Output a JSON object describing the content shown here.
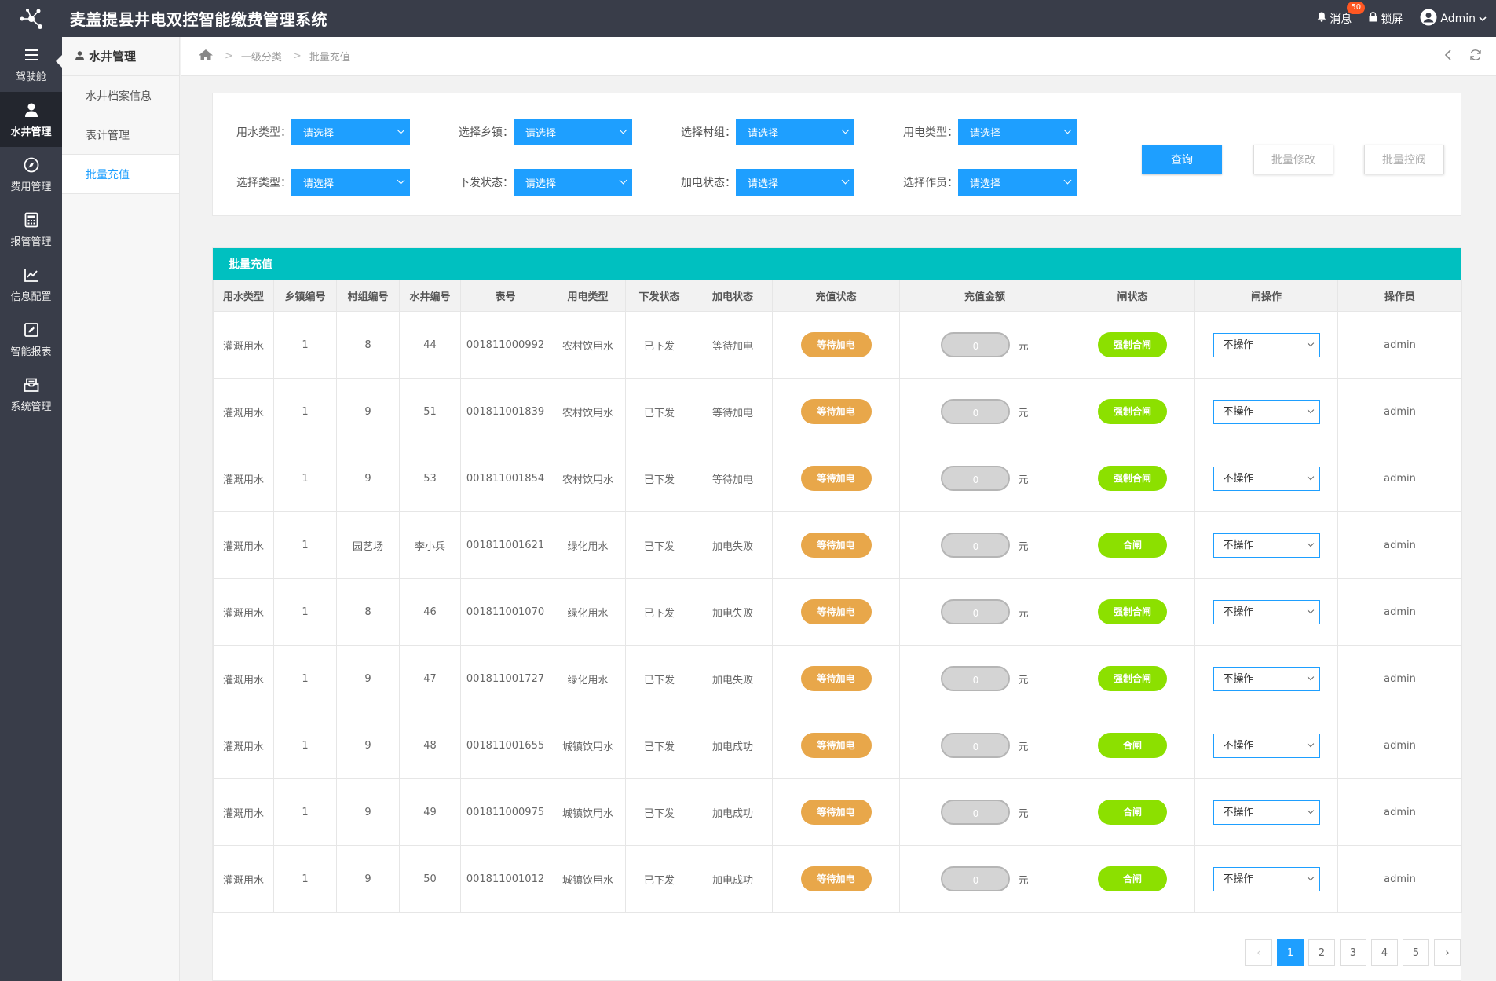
{
  "app": {
    "title": "麦盖提县井电双控智能缴费管理系统"
  },
  "topbar": {
    "messages_label": "消息",
    "messages_count": "50",
    "lock_label": "锁屏",
    "user_label": "Admin"
  },
  "sidebar": {
    "items": [
      {
        "label": "驾驶舱"
      },
      {
        "label": "水井管理"
      },
      {
        "label": "费用管理"
      },
      {
        "label": "报管管理"
      },
      {
        "label": "信息配置"
      },
      {
        "label": "智能报表"
      },
      {
        "label": "系统管理"
      }
    ]
  },
  "submenu": {
    "title": "水井管理",
    "items": [
      {
        "label": "水井档案信息"
      },
      {
        "label": "表计管理"
      },
      {
        "label": "批量充值"
      }
    ]
  },
  "breadcrumb": {
    "level1": "一级分类",
    "level2": "批量充值"
  },
  "filters": {
    "row1": [
      {
        "label": "用水类型：",
        "value": "请选择"
      },
      {
        "label": "选择乡镇：",
        "value": "请选择"
      },
      {
        "label": "选择村组：",
        "value": "请选择"
      },
      {
        "label": "用电类型：",
        "value": "请选择"
      }
    ],
    "row2": [
      {
        "label": "选择类型：",
        "value": "请选择"
      },
      {
        "label": "下发状态：",
        "value": "请选择"
      },
      {
        "label": "加电状态：",
        "value": "请选择"
      },
      {
        "label": "选择作员：",
        "value": "请选择"
      }
    ],
    "query_label": "查询",
    "batch_edit_label": "批量修改",
    "batch_valve_label": "批量控阀"
  },
  "table": {
    "title": "批量充值",
    "headers": [
      "用水类型",
      "乡镇编号",
      "村组编号",
      "水井编号",
      "表号",
      "用电类型",
      "下发状态",
      "加电状态",
      "充值状态",
      "充值金额",
      "闸状态",
      "闸操作",
      "操作员"
    ],
    "unit": "元",
    "rows": [
      {
        "water_type": "灌溉用水",
        "town": "1",
        "village": "8",
        "well": "44",
        "meter": "001811000992",
        "elec_type": "农村饮用水",
        "issue": "已下发",
        "power": "等待加电",
        "recharge": "等待加电",
        "amount": "0",
        "gate": "强制合闸",
        "gate_kind": "green",
        "op": "不操作",
        "operator": "admin"
      },
      {
        "water_type": "灌溉用水",
        "town": "1",
        "village": "9",
        "well": "51",
        "meter": "001811001839",
        "elec_type": "农村饮用水",
        "issue": "已下发",
        "power": "等待加电",
        "recharge": "等待加电",
        "amount": "0",
        "gate": "强制合闸",
        "gate_kind": "green",
        "op": "不操作",
        "operator": "admin"
      },
      {
        "water_type": "灌溉用水",
        "town": "1",
        "village": "9",
        "well": "53",
        "meter": "001811001854",
        "elec_type": "农村饮用水",
        "issue": "已下发",
        "power": "等待加电",
        "recharge": "等待加电",
        "amount": "0",
        "gate": "强制合闸",
        "gate_kind": "green",
        "op": "不操作",
        "operator": "admin"
      },
      {
        "water_type": "灌溉用水",
        "town": "1",
        "village": "园艺场",
        "well": "李小兵",
        "meter": "001811001621",
        "elec_type": "绿化用水",
        "issue": "已下发",
        "power": "加电失败",
        "recharge": "等待加电",
        "amount": "0",
        "gate": "合闸",
        "gate_kind": "green",
        "op": "不操作",
        "operator": "admin"
      },
      {
        "water_type": "灌溉用水",
        "town": "1",
        "village": "8",
        "well": "46",
        "meter": "001811001070",
        "elec_type": "绿化用水",
        "issue": "已下发",
        "power": "加电失败",
        "recharge": "等待加电",
        "amount": "0",
        "gate": "强制合闸",
        "gate_kind": "green",
        "op": "不操作",
        "operator": "admin"
      },
      {
        "water_type": "灌溉用水",
        "town": "1",
        "village": "9",
        "well": "47",
        "meter": "001811001727",
        "elec_type": "绿化用水",
        "issue": "已下发",
        "power": "加电失败",
        "recharge": "等待加电",
        "amount": "0",
        "gate": "强制合闸",
        "gate_kind": "green",
        "op": "不操作",
        "operator": "admin"
      },
      {
        "water_type": "灌溉用水",
        "town": "1",
        "village": "9",
        "well": "48",
        "meter": "001811001655",
        "elec_type": "城镇饮用水",
        "issue": "已下发",
        "power": "加电成功",
        "recharge": "等待加电",
        "amount": "0",
        "gate": "合闸",
        "gate_kind": "green",
        "op": "不操作",
        "operator": "admin"
      },
      {
        "water_type": "灌溉用水",
        "town": "1",
        "village": "9",
        "well": "49",
        "meter": "001811000975",
        "elec_type": "城镇饮用水",
        "issue": "已下发",
        "power": "加电成功",
        "recharge": "等待加电",
        "amount": "0",
        "gate": "合闸",
        "gate_kind": "green",
        "op": "不操作",
        "operator": "admin"
      },
      {
        "water_type": "灌溉用水",
        "town": "1",
        "village": "9",
        "well": "50",
        "meter": "001811001012",
        "elec_type": "城镇饮用水",
        "issue": "已下发",
        "power": "加电成功",
        "recharge": "等待加电",
        "amount": "0",
        "gate": "合闸",
        "gate_kind": "green",
        "op": "不操作",
        "operator": "admin"
      }
    ]
  },
  "pagination": {
    "prev": "‹",
    "next": "›",
    "pages": [
      "1",
      "2",
      "3",
      "4",
      "5"
    ],
    "current": "1"
  },
  "colors": {
    "topbar": "#393d49",
    "primary": "#1e9fff",
    "table_header": "#00c0c0",
    "pending": "#e8a74a",
    "gate_ok": "#8ce000"
  }
}
